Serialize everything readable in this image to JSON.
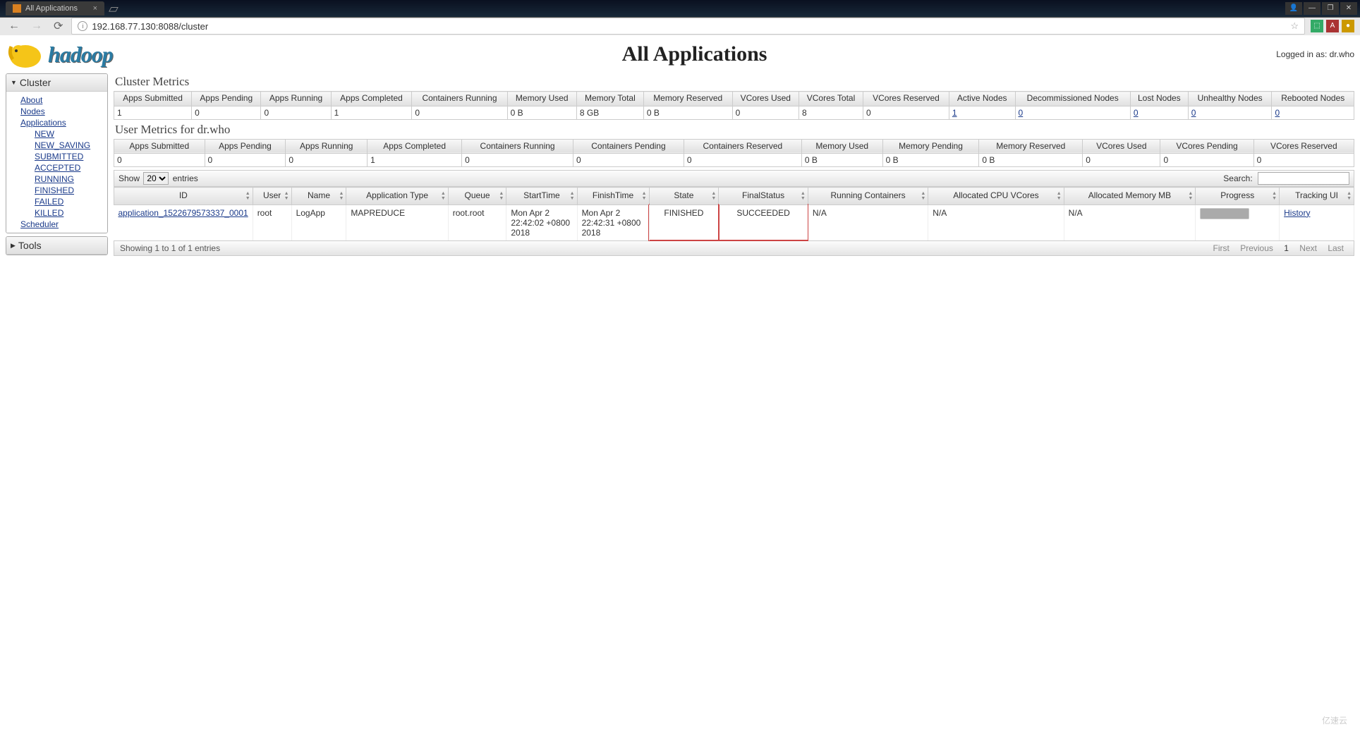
{
  "browser": {
    "tab_title": "All Applications",
    "url": "192.168.77.130:8088/cluster"
  },
  "header": {
    "logo_text": "hadoop",
    "page_title": "All Applications",
    "login_label": "Logged in as:",
    "login_user": "dr.who"
  },
  "sidebar": {
    "cluster_label": "Cluster",
    "tools_label": "Tools",
    "links": {
      "about": "About",
      "nodes": "Nodes",
      "applications": "Applications",
      "scheduler": "Scheduler"
    },
    "app_states": {
      "new": "NEW",
      "new_saving": "NEW_SAVING",
      "submitted": "SUBMITTED",
      "accepted": "ACCEPTED",
      "running": "RUNNING",
      "finished": "FINISHED",
      "failed": "FAILED",
      "killed": "KILLED"
    }
  },
  "cluster_metrics": {
    "title": "Cluster Metrics",
    "headers": {
      "apps_submitted": "Apps Submitted",
      "apps_pending": "Apps Pending",
      "apps_running": "Apps Running",
      "apps_completed": "Apps Completed",
      "containers_running": "Containers Running",
      "memory_used": "Memory Used",
      "memory_total": "Memory Total",
      "memory_reserved": "Memory Reserved",
      "vcores_used": "VCores Used",
      "vcores_total": "VCores Total",
      "vcores_reserved": "VCores Reserved",
      "active_nodes": "Active Nodes",
      "decom_nodes": "Decommissioned Nodes",
      "lost_nodes": "Lost Nodes",
      "unhealthy_nodes": "Unhealthy Nodes",
      "rebooted_nodes": "Rebooted Nodes"
    },
    "values": {
      "apps_submitted": "1",
      "apps_pending": "0",
      "apps_running": "0",
      "apps_completed": "1",
      "containers_running": "0",
      "memory_used": "0 B",
      "memory_total": "8 GB",
      "memory_reserved": "0 B",
      "vcores_used": "0",
      "vcores_total": "8",
      "vcores_reserved": "0",
      "active_nodes": "1",
      "decom_nodes": "0",
      "lost_nodes": "0",
      "unhealthy_nodes": "0",
      "rebooted_nodes": "0"
    }
  },
  "user_metrics": {
    "title": "User Metrics for dr.who",
    "headers": {
      "apps_submitted": "Apps Submitted",
      "apps_pending": "Apps Pending",
      "apps_running": "Apps Running",
      "apps_completed": "Apps Completed",
      "containers_running": "Containers Running",
      "containers_pending": "Containers Pending",
      "containers_reserved": "Containers Reserved",
      "memory_used": "Memory Used",
      "memory_pending": "Memory Pending",
      "memory_reserved": "Memory Reserved",
      "vcores_used": "VCores Used",
      "vcores_pending": "VCores Pending",
      "vcores_reserved": "VCores Reserved"
    },
    "values": {
      "apps_submitted": "0",
      "apps_pending": "0",
      "apps_running": "0",
      "apps_completed": "1",
      "containers_running": "0",
      "containers_pending": "0",
      "containers_reserved": "0",
      "memory_used": "0 B",
      "memory_pending": "0 B",
      "memory_reserved": "0 B",
      "vcores_used": "0",
      "vcores_pending": "0",
      "vcores_reserved": "0"
    }
  },
  "datatable": {
    "show_label": "Show",
    "entries_label": "entries",
    "show_value": "20",
    "search_label": "Search:",
    "search_value": "",
    "columns": {
      "id": "ID",
      "user": "User",
      "name": "Name",
      "app_type": "Application Type",
      "queue": "Queue",
      "start": "StartTime",
      "finish": "FinishTime",
      "state": "State",
      "final_status": "FinalStatus",
      "running_containers": "Running Containers",
      "alloc_cpu": "Allocated CPU VCores",
      "alloc_mem": "Allocated Memory MB",
      "progress": "Progress",
      "tracking": "Tracking UI"
    },
    "row": {
      "id": "application_1522679573337_0001",
      "user": "root",
      "name": "LogApp",
      "app_type": "MAPREDUCE",
      "queue": "root.root",
      "start": "Mon Apr 2 22:42:02 +0800 2018",
      "finish": "Mon Apr 2 22:42:31 +0800 2018",
      "state": "FINISHED",
      "final_status": "SUCCEEDED",
      "running_containers": "N/A",
      "alloc_cpu": "N/A",
      "alloc_mem": "N/A",
      "tracking": "History"
    },
    "footer_info": "Showing 1 to 1 of 1 entries",
    "paginate": {
      "first": "First",
      "previous": "Previous",
      "page": "1",
      "next": "Next",
      "last": "Last"
    }
  },
  "watermark": "亿速云"
}
